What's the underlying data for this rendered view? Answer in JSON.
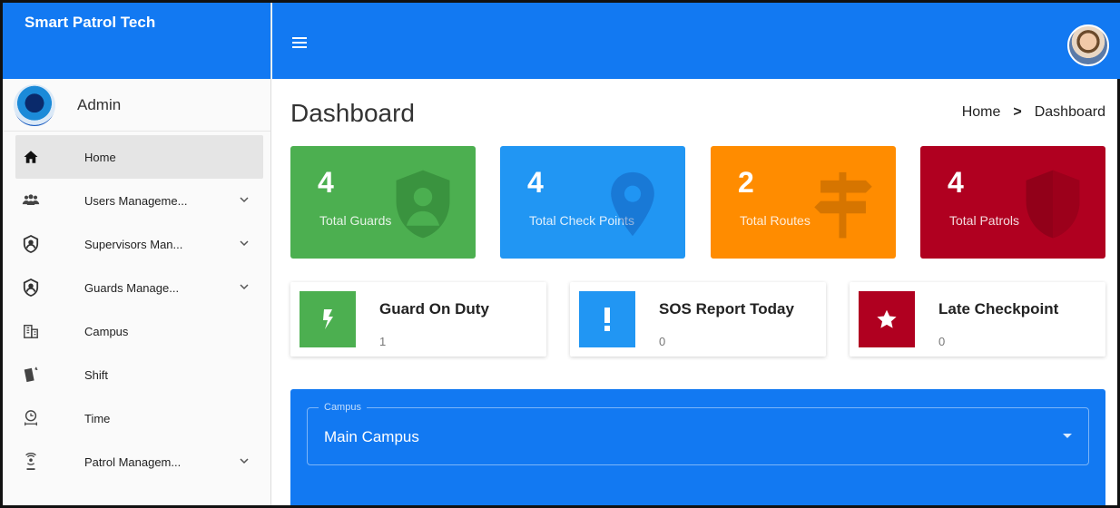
{
  "app": {
    "brand": "Smart Patrol Tech"
  },
  "sidebar": {
    "user": {
      "name": "Admin"
    },
    "items": [
      {
        "label": "Home",
        "icon": "home-icon",
        "active": true,
        "expandable": false
      },
      {
        "label": "Users Manageme...",
        "icon": "users-icon",
        "active": false,
        "expandable": true
      },
      {
        "label": "Supervisors Man...",
        "icon": "supervisor-icon",
        "active": false,
        "expandable": true
      },
      {
        "label": "Guards Manage...",
        "icon": "guard-icon",
        "active": false,
        "expandable": true
      },
      {
        "label": "Campus",
        "icon": "building-icon",
        "active": false,
        "expandable": false
      },
      {
        "label": "Shift",
        "icon": "shift-icon",
        "active": false,
        "expandable": false
      },
      {
        "label": "Time",
        "icon": "time-icon",
        "active": false,
        "expandable": false
      },
      {
        "label": "Patrol Managem...",
        "icon": "patrol-icon",
        "active": false,
        "expandable": true
      }
    ]
  },
  "page": {
    "title": "Dashboard",
    "breadcrumb": {
      "home": "Home",
      "separator": ">",
      "current": "Dashboard"
    }
  },
  "stats": [
    {
      "value": "4",
      "label": "Total Guards",
      "color": "#4caf50",
      "icon": "shield-user-icon"
    },
    {
      "value": "4",
      "label": "Total Check Points",
      "color": "#2196f3",
      "icon": "map-pin-icon"
    },
    {
      "value": "2",
      "label": "Total Routes",
      "color": "#ff8c00",
      "icon": "signpost-icon"
    },
    {
      "value": "4",
      "label": "Total Patrols",
      "color": "#b00020",
      "icon": "shield-icon"
    }
  ],
  "info_cards": [
    {
      "title": "Guard On Duty",
      "value": "1",
      "color": "#4caf50",
      "icon": "lightning-icon"
    },
    {
      "title": "SOS Report Today",
      "value": "0",
      "color": "#2196f3",
      "icon": "exclamation-icon"
    },
    {
      "title": "Late Checkpoint",
      "value": "0",
      "color": "#b00020",
      "icon": "star-icon"
    }
  ],
  "campus": {
    "label": "Campus",
    "value": "Main Campus"
  },
  "colors": {
    "primary": "#1279f2",
    "sidebar_active": "#e5e5e5"
  }
}
